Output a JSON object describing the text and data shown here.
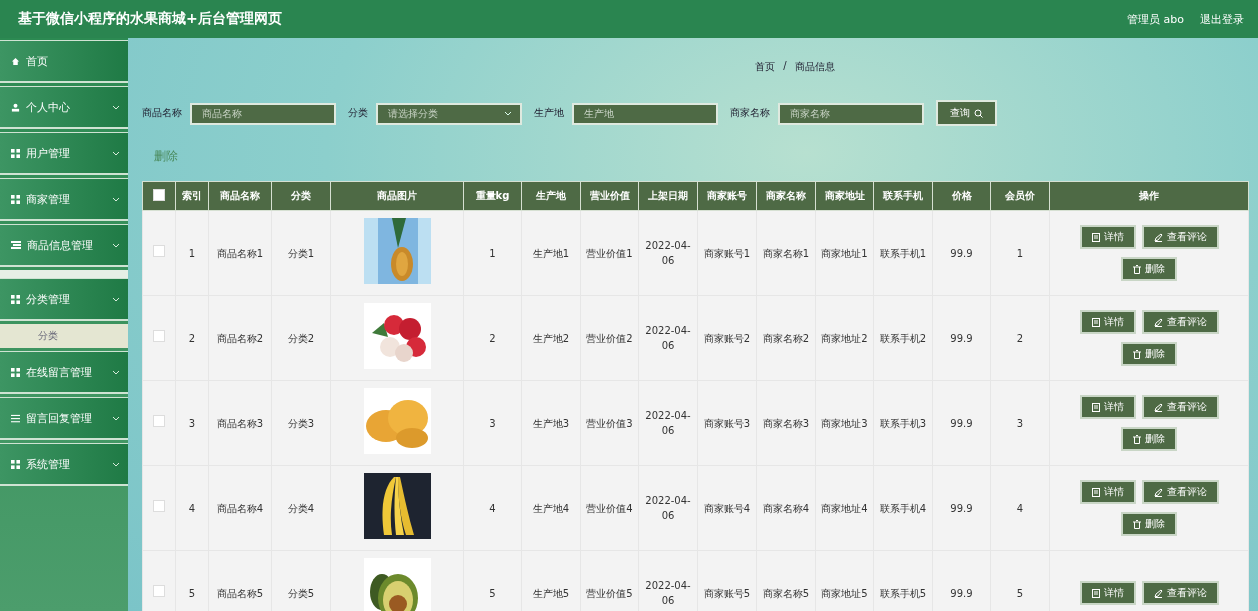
{
  "header": {
    "title": "基于微信小程序的水果商城+后台管理网页",
    "user": "管理员 abo",
    "logout": "退出登录"
  },
  "sidebar": {
    "items": [
      {
        "label": "首页",
        "kind": "link",
        "expanded": false
      },
      {
        "label": "个人中心",
        "kind": "menu",
        "expanded": false
      },
      {
        "label": "用户管理",
        "kind": "menu",
        "expanded": false
      },
      {
        "label": "商家管理",
        "kind": "menu",
        "expanded": false
      },
      {
        "label": "商品信息管理",
        "kind": "menu",
        "expanded": false
      },
      {
        "label": "分类管理",
        "kind": "menu",
        "expanded": true,
        "children": [
          {
            "label": "分类",
            "selected": true
          }
        ]
      },
      {
        "label": "在线留言管理",
        "kind": "menu",
        "expanded": false
      },
      {
        "label": "留言回复管理",
        "kind": "menu",
        "expanded": false
      },
      {
        "label": "系统管理",
        "kind": "menu",
        "expanded": false
      }
    ]
  },
  "breadcrumb": {
    "items": [
      "首页",
      "商品信息"
    ],
    "separator": "/"
  },
  "search": {
    "fields": [
      {
        "label": "商品名称",
        "kind": "input",
        "placeholder": "商品名称"
      },
      {
        "label": "分类",
        "kind": "select",
        "placeholder": "请选择分类"
      },
      {
        "label": "生产地",
        "kind": "input",
        "placeholder": "生产地"
      },
      {
        "label": "商家名称",
        "kind": "input",
        "placeholder": "商家名称"
      }
    ],
    "button": "查询"
  },
  "delete_link": "删除",
  "table": {
    "columns": [
      "索引",
      "商品名称",
      "分类",
      "商品图片",
      "重量kg",
      "生产地",
      "营业价值",
      "上架日期",
      "商家账号",
      "商家名称",
      "商家地址",
      "联系手机",
      "价格",
      "会员价",
      "操作"
    ],
    "header_checked": false,
    "rows": [
      {
        "checked": false,
        "cells": [
          "1",
          "商品名称1",
          "分类1",
          null,
          "1",
          "生产地1",
          "营业价值1",
          "2022-04-06",
          "商家账号1",
          "商家名称1",
          "商家地址1",
          "联系手机1",
          "99.9",
          "1"
        ],
        "actions": [
          "详情",
          "查看评论",
          "删除"
        ]
      },
      {
        "checked": false,
        "cells": [
          "2",
          "商品名称2",
          "分类2",
          null,
          "2",
          "生产地2",
          "营业价值2",
          "2022-04-06",
          "商家账号2",
          "商家名称2",
          "商家地址2",
          "联系手机2",
          "99.9",
          "2"
        ],
        "actions": [
          "详情",
          "查看评论",
          "删除"
        ]
      },
      {
        "checked": false,
        "cells": [
          "3",
          "商品名称3",
          "分类3",
          null,
          "3",
          "生产地3",
          "营业价值3",
          "2022-04-06",
          "商家账号3",
          "商家名称3",
          "商家地址3",
          "联系手机3",
          "99.9",
          "3"
        ],
        "actions": [
          "详情",
          "查看评论",
          "删除"
        ]
      },
      {
        "checked": false,
        "cells": [
          "4",
          "商品名称4",
          "分类4",
          null,
          "4",
          "生产地4",
          "营业价值4",
          "2022-04-06",
          "商家账号4",
          "商家名称4",
          "商家地址4",
          "联系手机4",
          "99.9",
          "4"
        ],
        "actions": [
          "详情",
          "查看评论",
          "删除"
        ]
      },
      {
        "checked": false,
        "cells": [
          "5",
          "商品名称5",
          "分类5",
          null,
          "5",
          "生产地5",
          "营业价值5",
          "2022-04-06",
          "商家账号5",
          "商家名称5",
          "商家地址5",
          "联系手机5",
          "99.9",
          "5"
        ],
        "actions": [
          "详情",
          "查看评论"
        ]
      }
    ]
  }
}
